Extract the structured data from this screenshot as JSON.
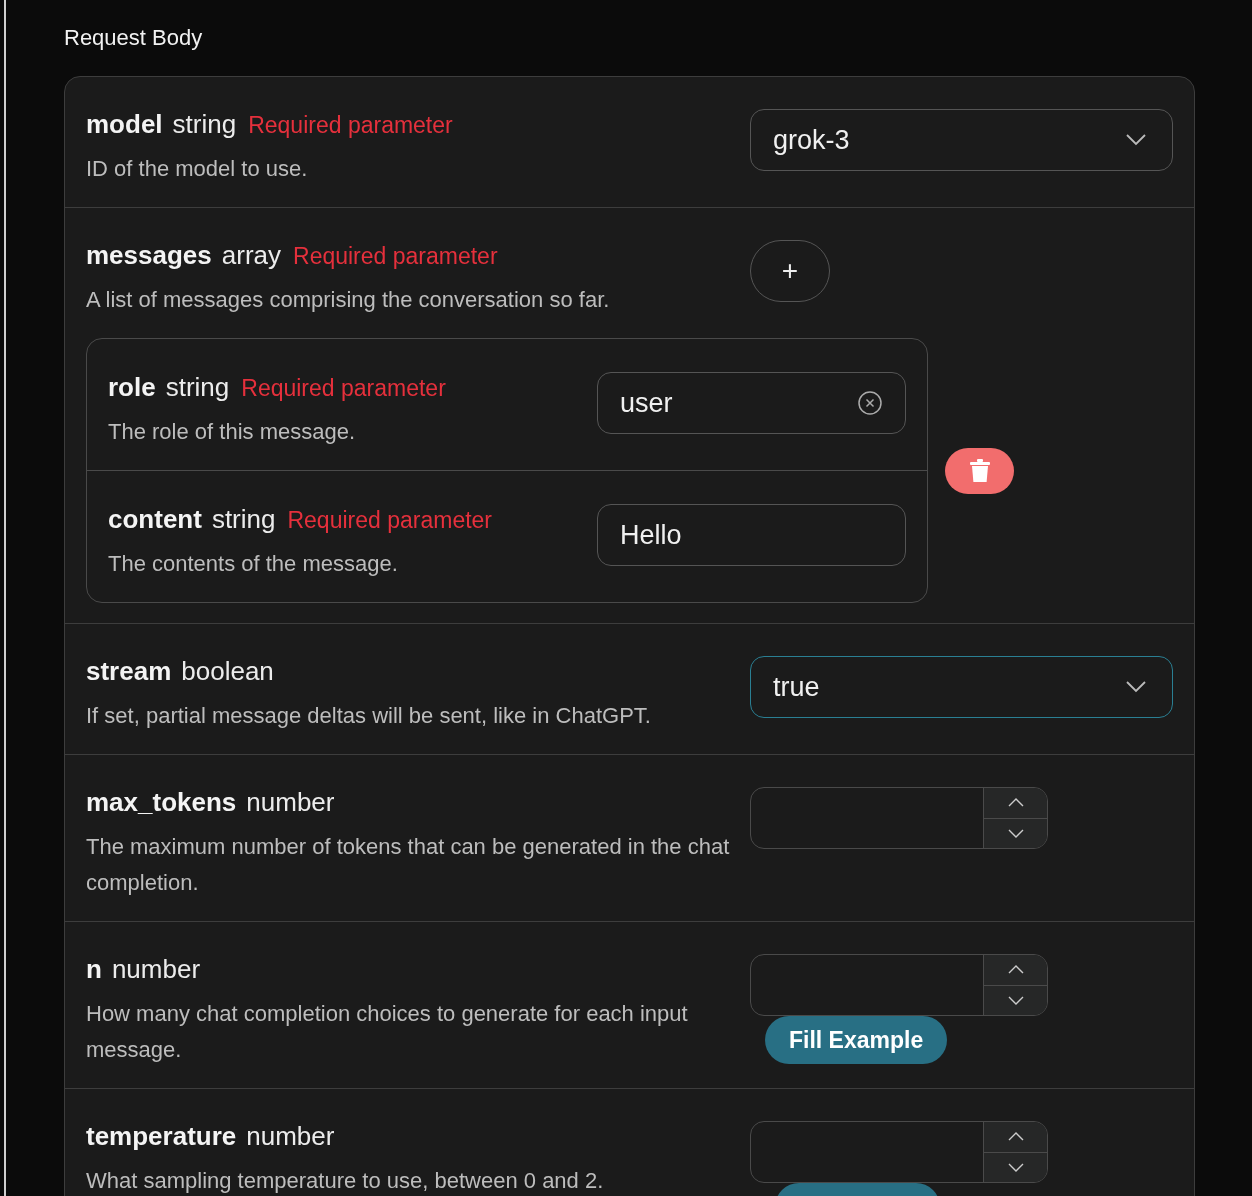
{
  "section_title": "Request Body",
  "params": [
    {
      "name": "model",
      "type": "string",
      "required_label": "Required parameter",
      "description": "ID of the model to use.",
      "control": {
        "kind": "select",
        "value": "grok-3",
        "focused": false
      }
    },
    {
      "name": "messages",
      "type": "array",
      "required_label": "Required parameter",
      "description": "A list of messages comprising the conversation so far.",
      "control": {
        "kind": "add",
        "label": "+"
      },
      "items": [
        {
          "name": "role",
          "type": "string",
          "required_label": "Required parameter",
          "description": "The role of this message.",
          "control": {
            "kind": "text",
            "value": "user",
            "clearable": true
          }
        },
        {
          "name": "content",
          "type": "string",
          "required_label": "Required parameter",
          "description": "The contents of the message.",
          "control": {
            "kind": "text",
            "value": "Hello",
            "clearable": false
          }
        }
      ]
    },
    {
      "name": "stream",
      "type": "boolean",
      "description": "If set, partial message deltas will be sent, like in ChatGPT.",
      "control": {
        "kind": "select",
        "value": "true",
        "focused": true
      }
    },
    {
      "name": "max_tokens",
      "type": "number",
      "description": "The maximum number of tokens that can be generated in the chat completion.",
      "control": {
        "kind": "number"
      }
    },
    {
      "name": "n",
      "type": "number",
      "description": "How many chat completion choices to generate for each input message.",
      "control": {
        "kind": "number",
        "example_button": "Fill Example"
      }
    },
    {
      "name": "temperature",
      "type": "number",
      "description": "What sampling temperature to use, between 0 and 2.",
      "control": {
        "kind": "number",
        "example_button_partial": true
      }
    }
  ]
}
